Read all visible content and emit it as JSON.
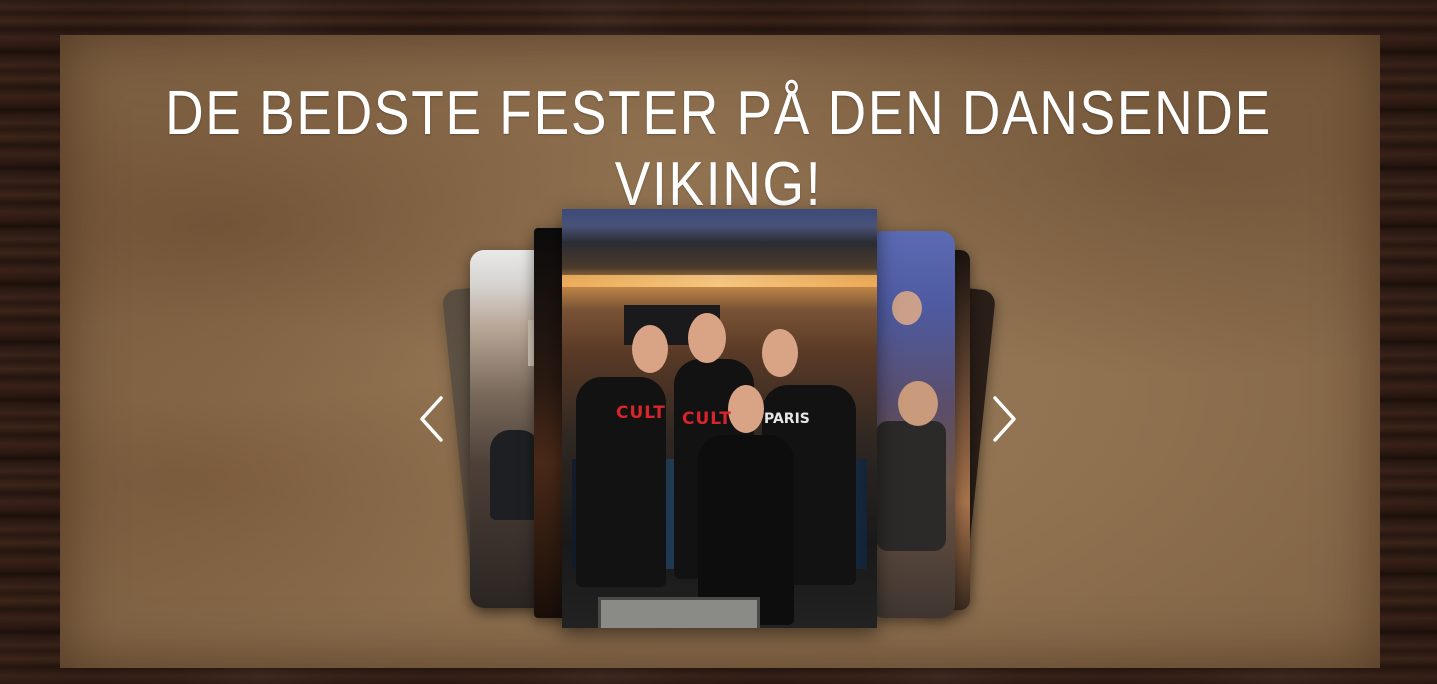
{
  "page": {
    "title": "DE BEDSTE FESTER PÅ DEN DANSENDE VIKING!"
  },
  "carousel": {
    "prev_icon": "chevron-left-icon",
    "next_icon": "chevron-right-icon",
    "center_slide": {
      "shirt_text_1": "CULT",
      "shirt_text_2": "CULT",
      "shirt_text_3": "PARIS"
    }
  },
  "colors": {
    "title": "#ffffff",
    "paper": "#8f7150",
    "wood": "#2b1a14",
    "arrow": "#ffffff"
  }
}
